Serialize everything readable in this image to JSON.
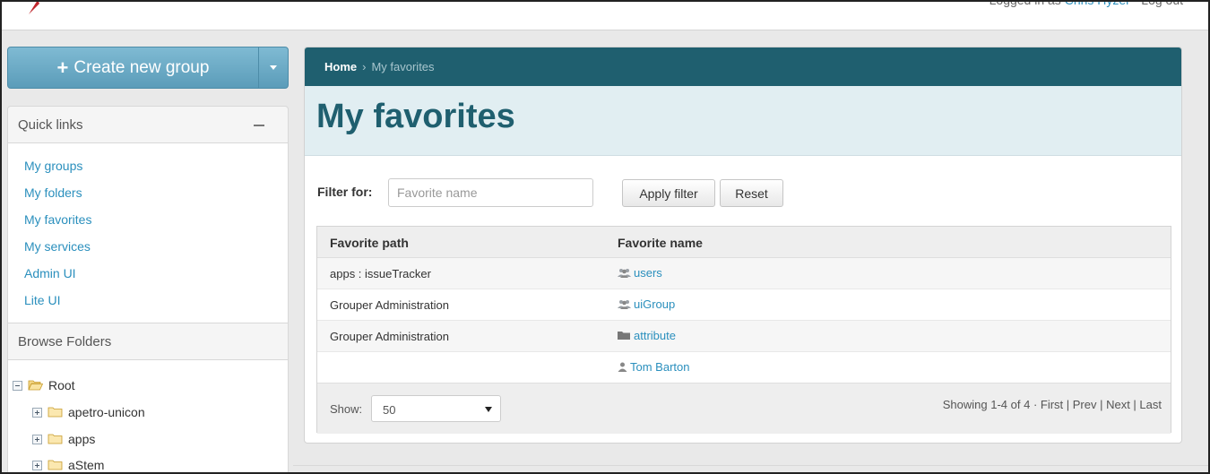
{
  "header": {
    "login_prefix": "Logged in as",
    "user_name": "Chris Hyzer",
    "logout": "Log out"
  },
  "sidebar": {
    "create_button": "Create new group",
    "quick_links": {
      "title": "Quick links",
      "items": [
        "My groups",
        "My folders",
        "My favorites",
        "My services",
        "Admin UI",
        "Lite UI"
      ]
    },
    "browse": {
      "title": "Browse Folders",
      "root": "Root",
      "folders": [
        "apetro-unicon",
        "apps",
        "aStem"
      ]
    }
  },
  "breadcrumb": {
    "home": "Home",
    "separator": "›",
    "current": "My favorites"
  },
  "page": {
    "title": "My favorites"
  },
  "filter": {
    "label": "Filter for:",
    "placeholder": "Favorite name",
    "apply": "Apply filter",
    "reset": "Reset"
  },
  "table": {
    "columns": [
      "Favorite path",
      "Favorite name"
    ],
    "rows": [
      {
        "path": "apps : issueTracker",
        "name": "users",
        "icon": "group-icon"
      },
      {
        "path": "Grouper Administration",
        "name": "uiGroup",
        "icon": "group-icon"
      },
      {
        "path": "Grouper Administration",
        "name": "attribute",
        "icon": "folder-icon"
      },
      {
        "path": "",
        "name": "Tom Barton",
        "icon": "person-icon"
      }
    ],
    "footer": {
      "show_label": "Show:",
      "show_value": "50",
      "paging": "Showing 1-4 of 4 · First | Prev | Next | Last"
    }
  },
  "colors": {
    "brand": "#1f5f6f",
    "link": "#2a8fbd",
    "button": "#6ea9c4"
  }
}
